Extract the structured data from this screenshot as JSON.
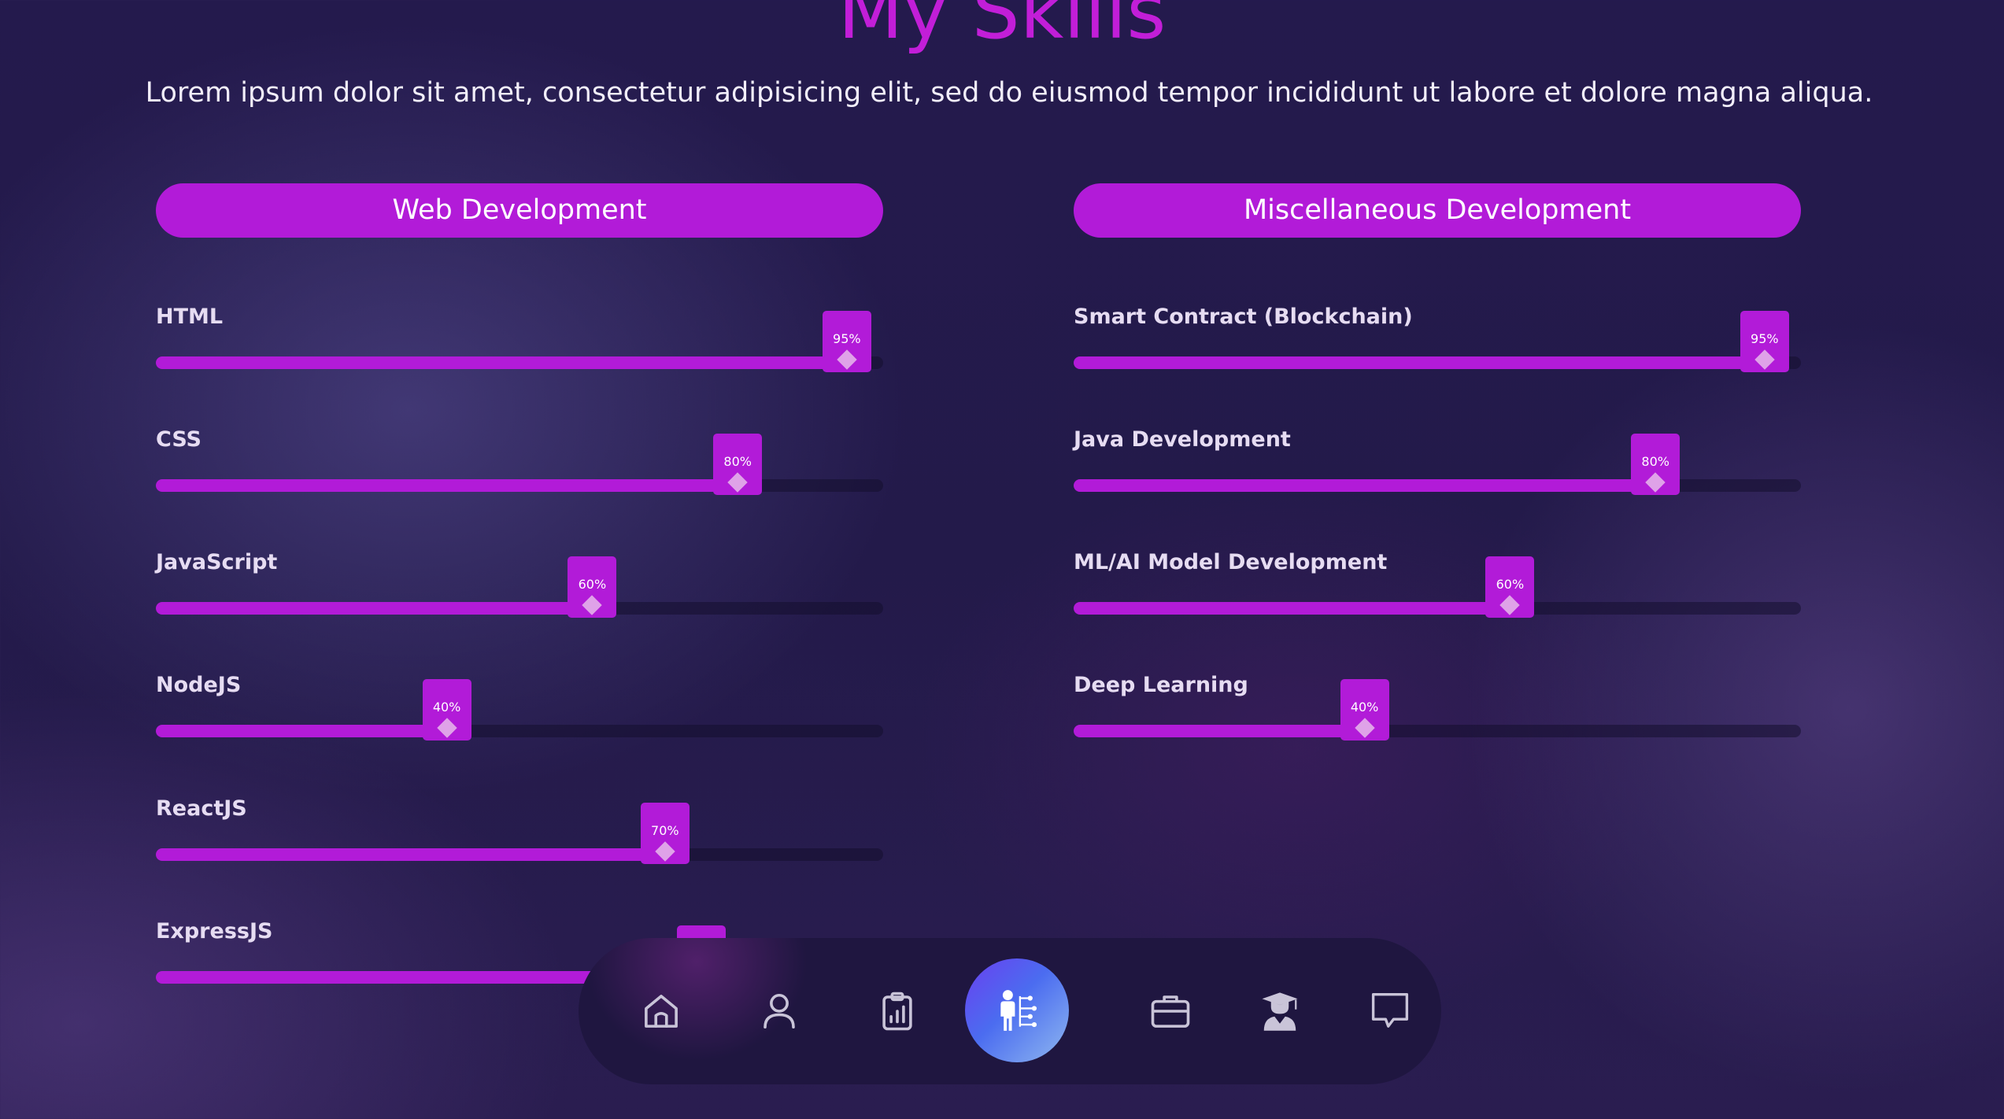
{
  "header": {
    "title": "My Skills",
    "subtitle": "Lorem ipsum dolor sit amet, consectetur adipisicing elit, sed do eiusmod tempor incididunt ut labore et dolore magna aliqua."
  },
  "categories": [
    {
      "label": "Web Development",
      "skills": [
        {
          "name": "HTML",
          "percent": 95,
          "percent_label": "95%"
        },
        {
          "name": "CSS",
          "percent": 80,
          "percent_label": "80%"
        },
        {
          "name": "JavaScript",
          "percent": 60,
          "percent_label": "60%"
        },
        {
          "name": "NodeJS",
          "percent": 40,
          "percent_label": "40%"
        },
        {
          "name": "ReactJS",
          "percent": 70,
          "percent_label": "70%"
        },
        {
          "name": "ExpressJS",
          "percent": 75,
          "percent_label": ""
        }
      ]
    },
    {
      "label": "Miscellaneous Development",
      "skills": [
        {
          "name": "Smart Contract (Blockchain)",
          "percent": 95,
          "percent_label": "95%"
        },
        {
          "name": "Java Development",
          "percent": 80,
          "percent_label": "80%"
        },
        {
          "name": "ML/AI Model Development",
          "percent": 60,
          "percent_label": "60%"
        },
        {
          "name": "Deep Learning",
          "percent": 40,
          "percent_label": "40%"
        }
      ]
    }
  ],
  "navbar": {
    "items": [
      {
        "icon": "home-icon"
      },
      {
        "icon": "user-icon"
      },
      {
        "icon": "clipboard-chart-icon"
      },
      {
        "icon": "skills-network-icon",
        "active": true
      },
      {
        "icon": "briefcase-icon"
      },
      {
        "icon": "graduate-icon"
      },
      {
        "icon": "chat-bubble-icon"
      }
    ]
  },
  "colors": {
    "accent": "#b21bd8",
    "title": "#c21ed8",
    "knob": "#dfa2e8",
    "active_nav_from": "#6a3ff0",
    "active_nav_to": "#8fb8f0"
  }
}
